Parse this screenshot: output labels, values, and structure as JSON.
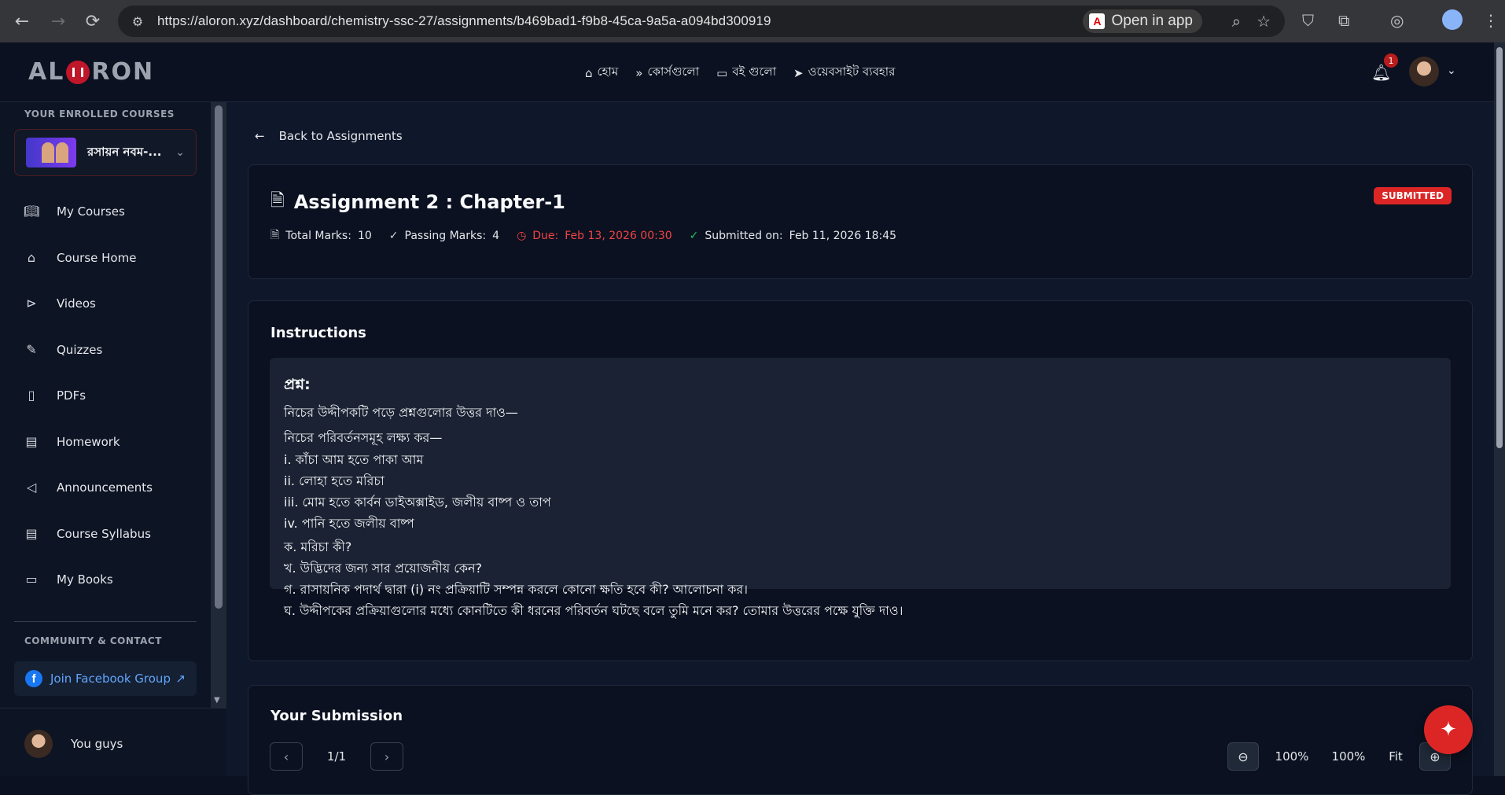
{
  "browser": {
    "url": "https://aloron.xyz/dashboard/chemistry-ssc-27/assignments/b469bad1-f9b8-45ca-9a5a-a094bd300919",
    "open_in_app": "Open in app"
  },
  "header": {
    "logo": "ALORON",
    "nav": [
      {
        "label": "হোম",
        "icon": "home-icon"
      },
      {
        "label": "কোর্সগুলো",
        "icon": "fast-forward-icon"
      },
      {
        "label": "বই গুলো",
        "icon": "book-icon"
      },
      {
        "label": "ওয়েবসাইট ব্যবহার",
        "icon": "send-icon"
      }
    ],
    "notification_count": "1"
  },
  "sidebar": {
    "enrolled_label": "YOUR ENROLLED COURSES",
    "course_name": "রসায়ন নবম-...",
    "items": [
      {
        "label": "My Courses",
        "icon": "book-open-icon"
      },
      {
        "label": "Course Home",
        "icon": "home-icon"
      },
      {
        "label": "Videos",
        "icon": "play-circle-icon"
      },
      {
        "label": "Quizzes",
        "icon": "pen-icon"
      },
      {
        "label": "PDFs",
        "icon": "file-icon"
      },
      {
        "label": "Homework",
        "icon": "clipboard-icon"
      },
      {
        "label": "Announcements",
        "icon": "megaphone-icon"
      },
      {
        "label": "Course Syllabus",
        "icon": "file-text-icon"
      },
      {
        "label": "My Books",
        "icon": "book-icon"
      }
    ],
    "community_label": "COMMUNITY & CONTACT",
    "facebook_label": "Join Facebook Group",
    "user_name": "You guys"
  },
  "main": {
    "back_label": "Back to Assignments",
    "assignment": {
      "title": "Assignment 2 : Chapter-1",
      "status": "SUBMITTED",
      "total_marks_label": "Total Marks:",
      "total_marks": "10",
      "passing_marks_label": "Passing Marks:",
      "passing_marks": "4",
      "due_label": "Due:",
      "due": "Feb 13, 2026 00:30",
      "submitted_label": "Submitted on:",
      "submitted": "Feb 11, 2026 18:45"
    },
    "instructions": {
      "heading": "Instructions",
      "question_label": "প্রশ্ন:",
      "lines": [
        "নিচের উদ্দীপকটি পড়ে প্রশ্নগুলোর উত্তর দাও—",
        "নিচের পরিবর্তনসমূহ লক্ষ্য কর—",
        "i. কাঁচা আম হতে পাকা আম",
        "ii. লোহা হতে মরিচা",
        "iii. মোম হতে কার্বন ডাইঅক্সাইড, জলীয় বাষ্প ও তাপ",
        "iv. পানি হতে জলীয় বাষ্প",
        "ক. মরিচা কী?",
        "খ. উদ্ভিদের জন্য সার প্রয়োজনীয় কেন?",
        "গ. রাসায়নিক পদার্থ দ্বারা (i) নং প্রক্রিয়াটি সম্পন্ন করলে কোনো ক্ষতি হবে কী? আলোচনা কর।",
        "ঘ. উদ্দীপকের প্রক্রিয়াগুলোর মধ্যে কোনটিতে কী ধরনের পরিবর্তন ঘটছে বলে তুমি মনে কর? তোমার উত্তরের পক্ষে যুক্তি দাও।"
      ]
    },
    "submission": {
      "heading": "Your Submission",
      "page": "1/1",
      "zoom_a": "100%",
      "zoom_b": "100%",
      "fit": "Fit"
    }
  },
  "colors": {
    "accent": "#dc2626",
    "bg": "#0b1120",
    "due": "#ef4444",
    "ok": "#22c55e"
  }
}
